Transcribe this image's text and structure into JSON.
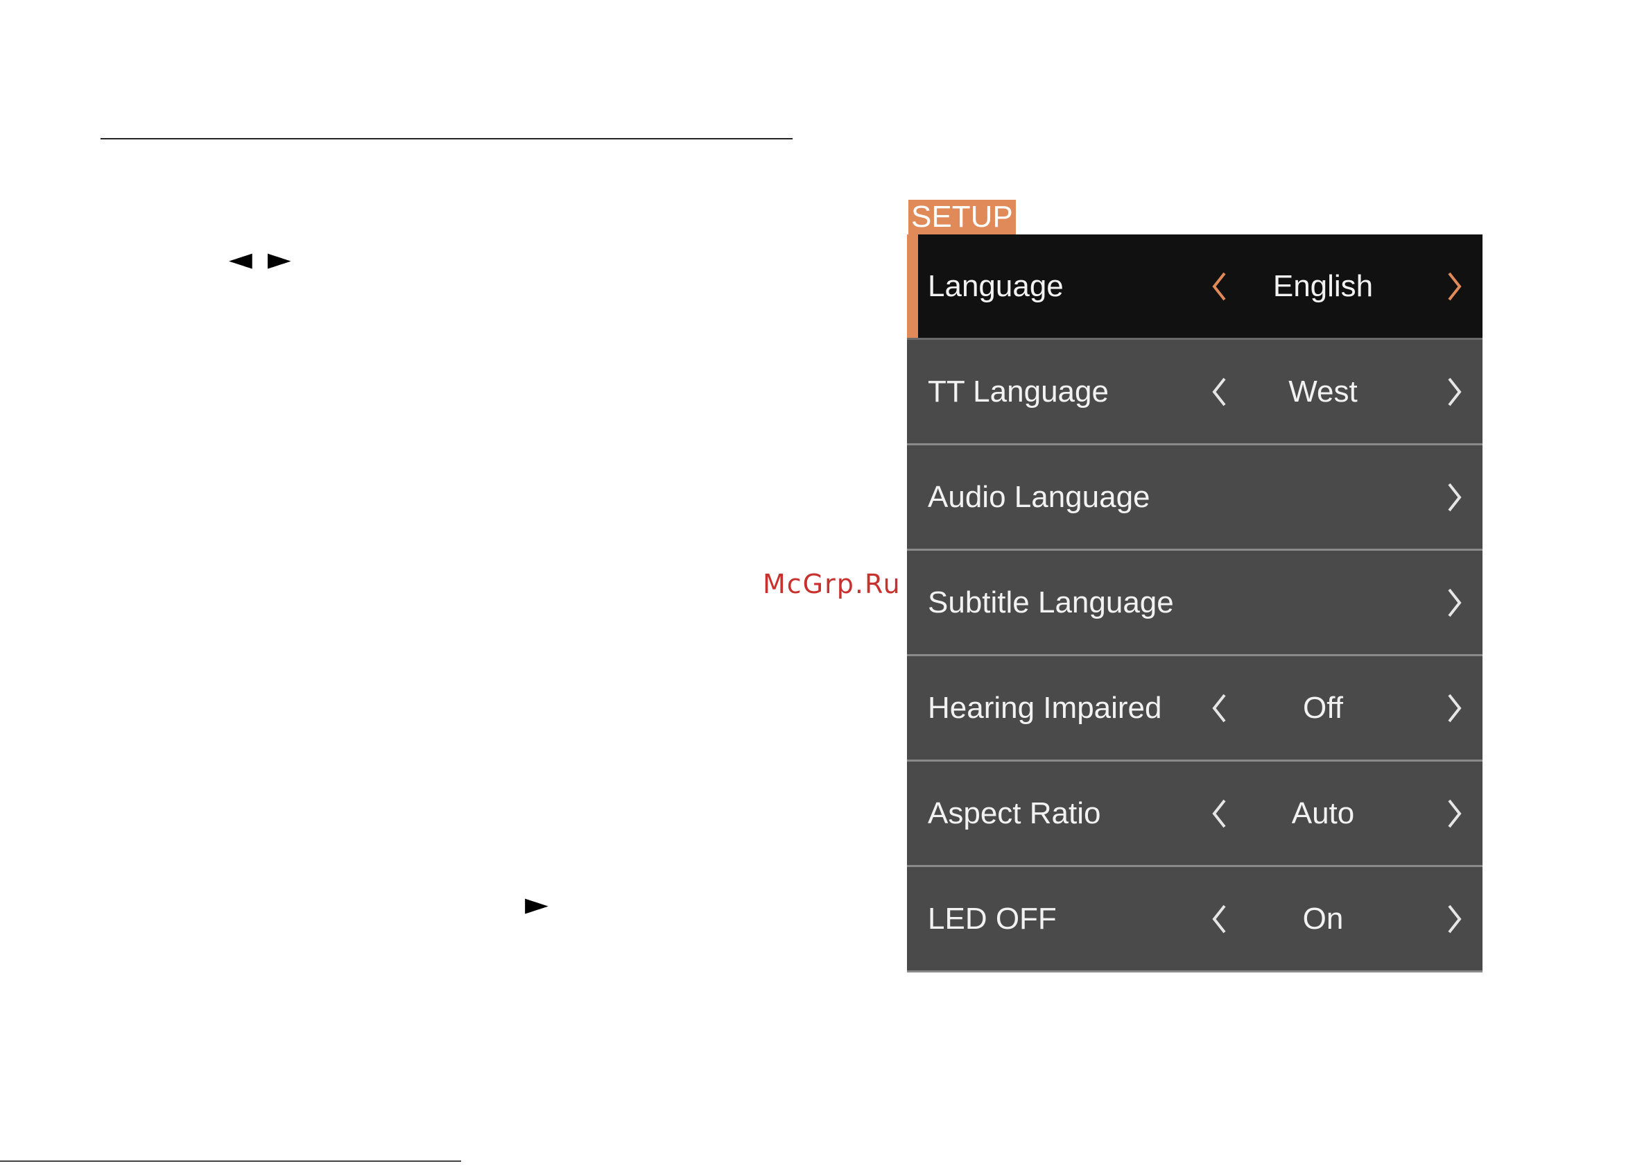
{
  "doc": {
    "arrows_left_right": "◄ ►",
    "arrow_right": "►",
    "watermark": "McGrp.Ru"
  },
  "setup": {
    "title": "SETUP",
    "accent_color": "#e08a5a",
    "selected_background": "#111111",
    "row_background": "#4a4a4a",
    "rows": [
      {
        "label": "Language",
        "value": "English",
        "has_left": true,
        "has_right": true,
        "selected": true
      },
      {
        "label": "TT Language",
        "value": "West",
        "has_left": true,
        "has_right": true,
        "selected": false
      },
      {
        "label": "Audio Language",
        "value": "",
        "has_left": false,
        "has_right": true,
        "selected": false
      },
      {
        "label": "Subtitle Language",
        "value": "",
        "has_left": false,
        "has_right": true,
        "selected": false
      },
      {
        "label": "Hearing Impaired",
        "value": "Off",
        "has_left": true,
        "has_right": true,
        "selected": false
      },
      {
        "label": "Aspect Ratio",
        "value": "Auto",
        "has_left": true,
        "has_right": true,
        "selected": false
      },
      {
        "label": "LED OFF",
        "value": "On",
        "has_left": true,
        "has_right": true,
        "selected": false
      }
    ]
  }
}
